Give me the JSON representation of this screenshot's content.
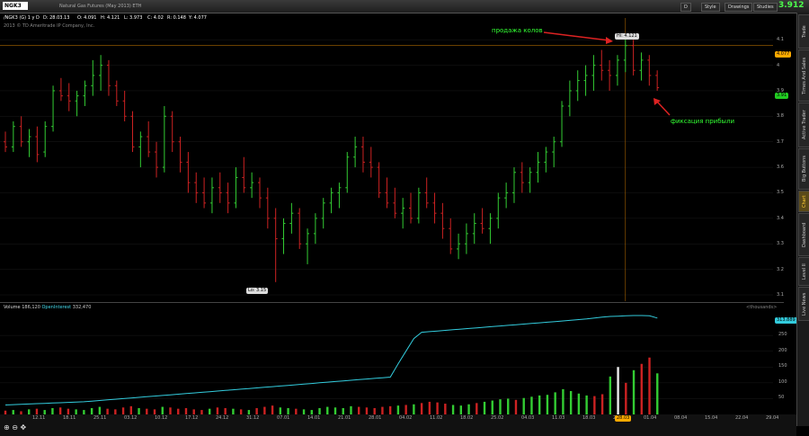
{
  "toolbar": {
    "symbol": "NGK3",
    "description": "Natural Gas Futures (May 2013) ETH",
    "buttons": {
      "style": "Style",
      "drawings": "Drawings",
      "studies": "Studies",
      "period": "D"
    },
    "last_price": "3.912"
  },
  "infobar": {
    "symbol_period": "/NGK3 (G) 1 y D",
    "date": "D: 28.03.13",
    "open": "O: 4.091",
    "high": "H: 4.121",
    "low": "L: 3.973",
    "close": "C: 4.02",
    "range": "R: 0.148",
    "y": "Y: 4.077"
  },
  "copyright": "2013 © TD Ameritrade IP Company, Inc.",
  "annotations": {
    "sell": "продажа колов",
    "fix": "фиксация прибыли",
    "hi_tag": "Hi: 4.121",
    "lo_tag": "Lo: 3.15"
  },
  "price_axis": {
    "ticks": [
      "4.1",
      "4",
      "3.9",
      "3.8",
      "3.7",
      "3.6",
      "3.5",
      "3.4",
      "3.3",
      "3.2",
      "3.1"
    ],
    "current_tag": "4.077",
    "last_tag": "3.91"
  },
  "volume_panel": {
    "volume_label": "Volume",
    "volume_value": "186,120",
    "oi_label": "OpenInterest",
    "oi_value": "332,470",
    "units": "<thousands>",
    "oi_tag": "313.889",
    "ticks": [
      "250",
      "200",
      "150",
      "100",
      "50"
    ]
  },
  "dates": [
    "12.11",
    "18.11",
    "25.11",
    "03.12",
    "10.12",
    "17.12",
    "24.12",
    "31.12",
    "07.01",
    "14.01",
    "21.01",
    "28.01",
    "04.02",
    "11.02",
    "18.02",
    "25.02",
    "04.03",
    "11.03",
    "18.03",
    "25.03",
    "01.04",
    "08.04",
    "15.04",
    "22.04",
    "29.04"
  ],
  "cursor_date": "28.03",
  "right_tabs": [
    "Trade",
    "Times And Sales",
    "Active Trader",
    "Big Buttons",
    "Chart",
    "Dashboard",
    "Level II",
    "Live News"
  ],
  "active_tab": "Chart",
  "chart_data": {
    "type": "ohlc",
    "ylim": [
      3.1,
      4.15
    ],
    "bars": [
      [
        3.7,
        3.74,
        3.66,
        3.68
      ],
      [
        3.68,
        3.78,
        3.66,
        3.76
      ],
      [
        3.76,
        3.8,
        3.68,
        3.7
      ],
      [
        3.7,
        3.75,
        3.64,
        3.72
      ],
      [
        3.72,
        3.76,
        3.62,
        3.65
      ],
      [
        3.66,
        3.78,
        3.64,
        3.76
      ],
      [
        3.76,
        3.92,
        3.74,
        3.9
      ],
      [
        3.9,
        3.95,
        3.86,
        3.88
      ],
      [
        3.88,
        3.93,
        3.82,
        3.86
      ],
      [
        3.86,
        3.9,
        3.8,
        3.88
      ],
      [
        3.88,
        3.94,
        3.84,
        3.92
      ],
      [
        3.92,
        4.02,
        3.88,
        3.96
      ],
      [
        3.96,
        4.04,
        3.9,
        4.0
      ],
      [
        4.0,
        4.02,
        3.88,
        3.92
      ],
      [
        3.92,
        3.94,
        3.84,
        3.86
      ],
      [
        3.86,
        3.9,
        3.78,
        3.8
      ],
      [
        3.8,
        3.82,
        3.66,
        3.68
      ],
      [
        3.68,
        3.74,
        3.6,
        3.72
      ],
      [
        3.72,
        3.78,
        3.64,
        3.66
      ],
      [
        3.66,
        3.7,
        3.56,
        3.6
      ],
      [
        3.6,
        3.84,
        3.58,
        3.8
      ],
      [
        3.8,
        3.82,
        3.66,
        3.7
      ],
      [
        3.7,
        3.72,
        3.58,
        3.62
      ],
      [
        3.62,
        3.66,
        3.5,
        3.54
      ],
      [
        3.54,
        3.58,
        3.46,
        3.5
      ],
      [
        3.5,
        3.56,
        3.44,
        3.46
      ],
      [
        3.46,
        3.56,
        3.42,
        3.52
      ],
      [
        3.52,
        3.58,
        3.46,
        3.5
      ],
      [
        3.5,
        3.54,
        3.42,
        3.46
      ],
      [
        3.46,
        3.6,
        3.44,
        3.56
      ],
      [
        3.56,
        3.64,
        3.5,
        3.52
      ],
      [
        3.52,
        3.58,
        3.48,
        3.54
      ],
      [
        3.54,
        3.56,
        3.44,
        3.48
      ],
      [
        3.48,
        3.52,
        3.36,
        3.4
      ],
      [
        3.4,
        3.44,
        3.15,
        3.32
      ],
      [
        3.32,
        3.4,
        3.26,
        3.38
      ],
      [
        3.38,
        3.46,
        3.34,
        3.42
      ],
      [
        3.42,
        3.44,
        3.28,
        3.3
      ],
      [
        3.3,
        3.36,
        3.22,
        3.34
      ],
      [
        3.34,
        3.42,
        3.3,
        3.4
      ],
      [
        3.4,
        3.48,
        3.36,
        3.46
      ],
      [
        3.46,
        3.52,
        3.42,
        3.5
      ],
      [
        3.5,
        3.54,
        3.44,
        3.52
      ],
      [
        3.52,
        3.66,
        3.5,
        3.64
      ],
      [
        3.64,
        3.72,
        3.6,
        3.68
      ],
      [
        3.68,
        3.72,
        3.58,
        3.62
      ],
      [
        3.62,
        3.68,
        3.56,
        3.6
      ],
      [
        3.6,
        3.62,
        3.48,
        3.5
      ],
      [
        3.5,
        3.56,
        3.44,
        3.46
      ],
      [
        3.46,
        3.52,
        3.4,
        3.42
      ],
      [
        3.42,
        3.48,
        3.36,
        3.44
      ],
      [
        3.44,
        3.5,
        3.38,
        3.4
      ],
      [
        3.4,
        3.52,
        3.38,
        3.5
      ],
      [
        3.5,
        3.56,
        3.44,
        3.46
      ],
      [
        3.46,
        3.5,
        3.38,
        3.42
      ],
      [
        3.42,
        3.46,
        3.32,
        3.36
      ],
      [
        3.36,
        3.4,
        3.26,
        3.28
      ],
      [
        3.28,
        3.34,
        3.24,
        3.3
      ],
      [
        3.3,
        3.38,
        3.26,
        3.34
      ],
      [
        3.34,
        3.42,
        3.3,
        3.38
      ],
      [
        3.38,
        3.44,
        3.34,
        3.36
      ],
      [
        3.36,
        3.42,
        3.3,
        3.4
      ],
      [
        3.4,
        3.5,
        3.36,
        3.48
      ],
      [
        3.48,
        3.54,
        3.44,
        3.5
      ],
      [
        3.5,
        3.6,
        3.46,
        3.58
      ],
      [
        3.58,
        3.62,
        3.5,
        3.54
      ],
      [
        3.54,
        3.6,
        3.5,
        3.58
      ],
      [
        3.58,
        3.66,
        3.54,
        3.62
      ],
      [
        3.62,
        3.68,
        3.58,
        3.66
      ],
      [
        3.66,
        3.72,
        3.6,
        3.7
      ],
      [
        3.7,
        3.86,
        3.68,
        3.84
      ],
      [
        3.84,
        3.94,
        3.8,
        3.9
      ],
      [
        3.9,
        3.98,
        3.86,
        3.94
      ],
      [
        3.94,
        4.0,
        3.88,
        3.96
      ],
      [
        3.96,
        4.04,
        3.9,
        4.0
      ],
      [
        4.0,
        4.06,
        3.94,
        3.98
      ],
      [
        3.98,
        4.02,
        3.9,
        3.96
      ],
      [
        3.96,
        4.04,
        3.92,
        4.02
      ],
      [
        4.02,
        4.121,
        3.973,
        4.077
      ],
      [
        4.077,
        4.1,
        3.96,
        3.98
      ],
      [
        3.98,
        4.05,
        3.94,
        4.02
      ],
      [
        4.02,
        4.04,
        3.92,
        3.96
      ],
      [
        3.96,
        3.98,
        3.9,
        3.912
      ]
    ],
    "volume": [
      12,
      14,
      10,
      16,
      18,
      14,
      20,
      22,
      18,
      16,
      14,
      20,
      24,
      18,
      16,
      22,
      26,
      20,
      18,
      16,
      24,
      22,
      18,
      20,
      16,
      14,
      18,
      22,
      20,
      18,
      16,
      14,
      20,
      24,
      28,
      22,
      20,
      18,
      16,
      14,
      20,
      24,
      22,
      20,
      26,
      24,
      22,
      20,
      24,
      26,
      28,
      30,
      32,
      36,
      40,
      38,
      34,
      30,
      28,
      32,
      36,
      40,
      44,
      48,
      50,
      46,
      52,
      56,
      60,
      62,
      70,
      80,
      74,
      66,
      60,
      58,
      64,
      120,
      150,
      100,
      140,
      160,
      180,
      130
    ],
    "open_interest": [
      30,
      31,
      32,
      33,
      34,
      35,
      36,
      37,
      38,
      39,
      40,
      42,
      44,
      46,
      48,
      50,
      52,
      54,
      56,
      58,
      60,
      62,
      64,
      66,
      68,
      70,
      72,
      74,
      76,
      78,
      80,
      82,
      84,
      86,
      88,
      90,
      92,
      94,
      96,
      98,
      100,
      102,
      104,
      106,
      108,
      110,
      112,
      114,
      116,
      118,
      160,
      200,
      240,
      260,
      262,
      264,
      266,
      268,
      270,
      272,
      274,
      276,
      278,
      280,
      282,
      284,
      286,
      288,
      290,
      292,
      294,
      296,
      298,
      300,
      302,
      305,
      308,
      310,
      311,
      312,
      313,
      313,
      312,
      305
    ],
    "up_color": "#33cc33",
    "down_color": "#cc2222"
  }
}
